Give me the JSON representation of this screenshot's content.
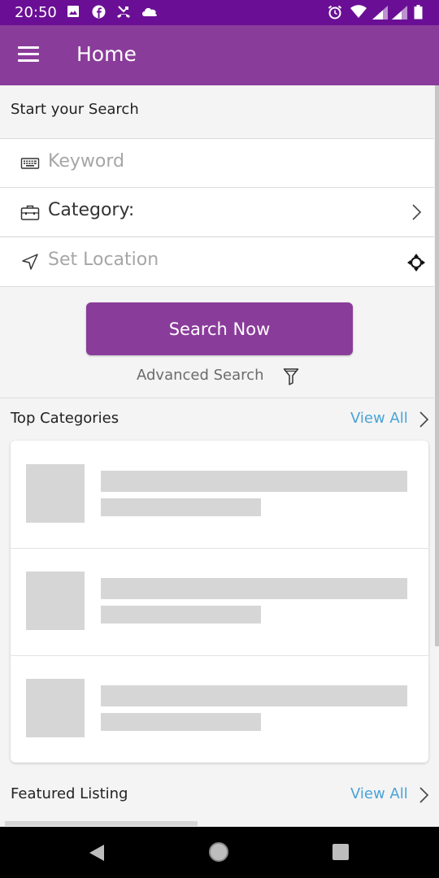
{
  "status_bar": {
    "time": "20:50",
    "left_icons": [
      "image-icon",
      "facebook-icon",
      "missed-call-icon",
      "cloud-icon"
    ],
    "right_icons": [
      "alarm-icon",
      "wifi-icon",
      "signal-icon",
      "signal-icon",
      "battery-icon"
    ]
  },
  "app_bar": {
    "title": "Home",
    "menu_icon": "hamburger-menu-icon"
  },
  "search": {
    "header": "Start your Search",
    "keyword_placeholder": "Keyword",
    "category_label": "Category:",
    "location_placeholder": "Set Location",
    "button_label": "Search Now",
    "advanced_label": "Advanced Search"
  },
  "top_categories": {
    "title": "Top Categories",
    "view_all": "View All",
    "placeholder_rows": 3
  },
  "featured": {
    "title": "Featured Listing",
    "view_all": "View All"
  },
  "colors": {
    "status_bar": "#6a0f95",
    "app_bar": "#8a3c9a",
    "accent_link": "#4aa3d6",
    "placeholder_gray": "#d6d6d6"
  }
}
